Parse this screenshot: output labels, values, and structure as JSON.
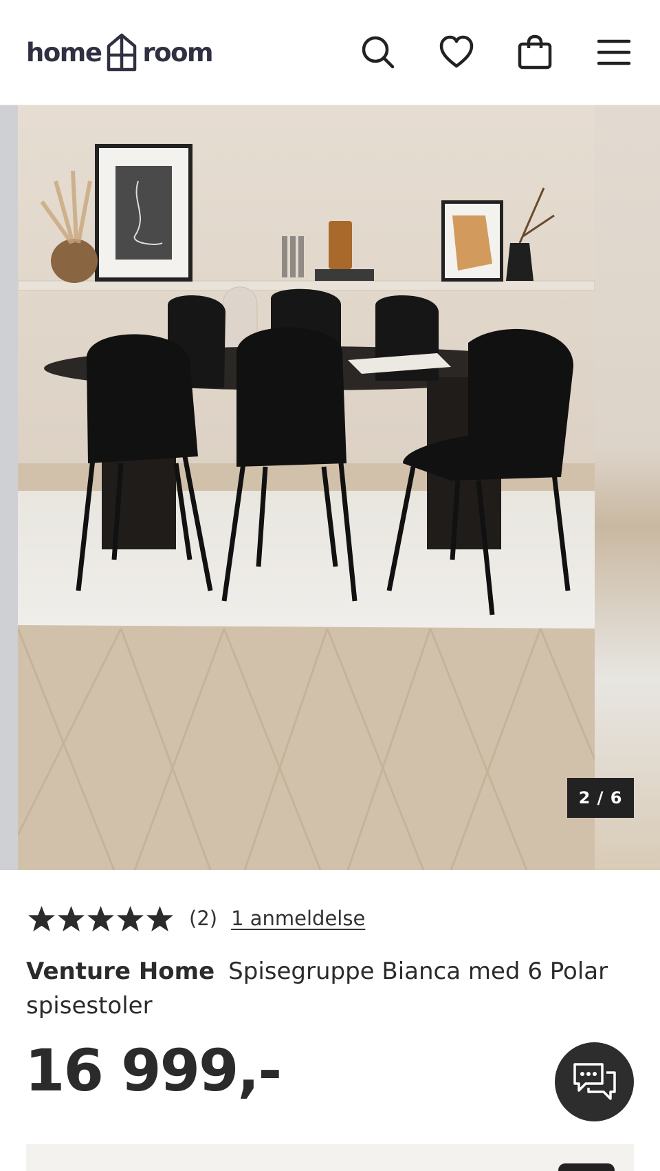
{
  "brand": {
    "logo_left": "home",
    "logo_right": "room"
  },
  "header": {
    "icons": [
      "search-icon",
      "heart-icon",
      "shopping-bag-icon",
      "menu-icon"
    ]
  },
  "gallery": {
    "counter": "2 / 6",
    "current": 2,
    "total": 6
  },
  "rating": {
    "stars": 5,
    "count": "(2)",
    "reviews_link": "1 anmeldelse"
  },
  "product": {
    "brand": "Venture Home",
    "name": "Spisegruppe Bianca med 6 Polar spisestoler",
    "price": "16 999,-"
  },
  "colors": {
    "dark": "#2d2d2d",
    "logo": "#2f3142",
    "star": "#2b2b2b"
  }
}
